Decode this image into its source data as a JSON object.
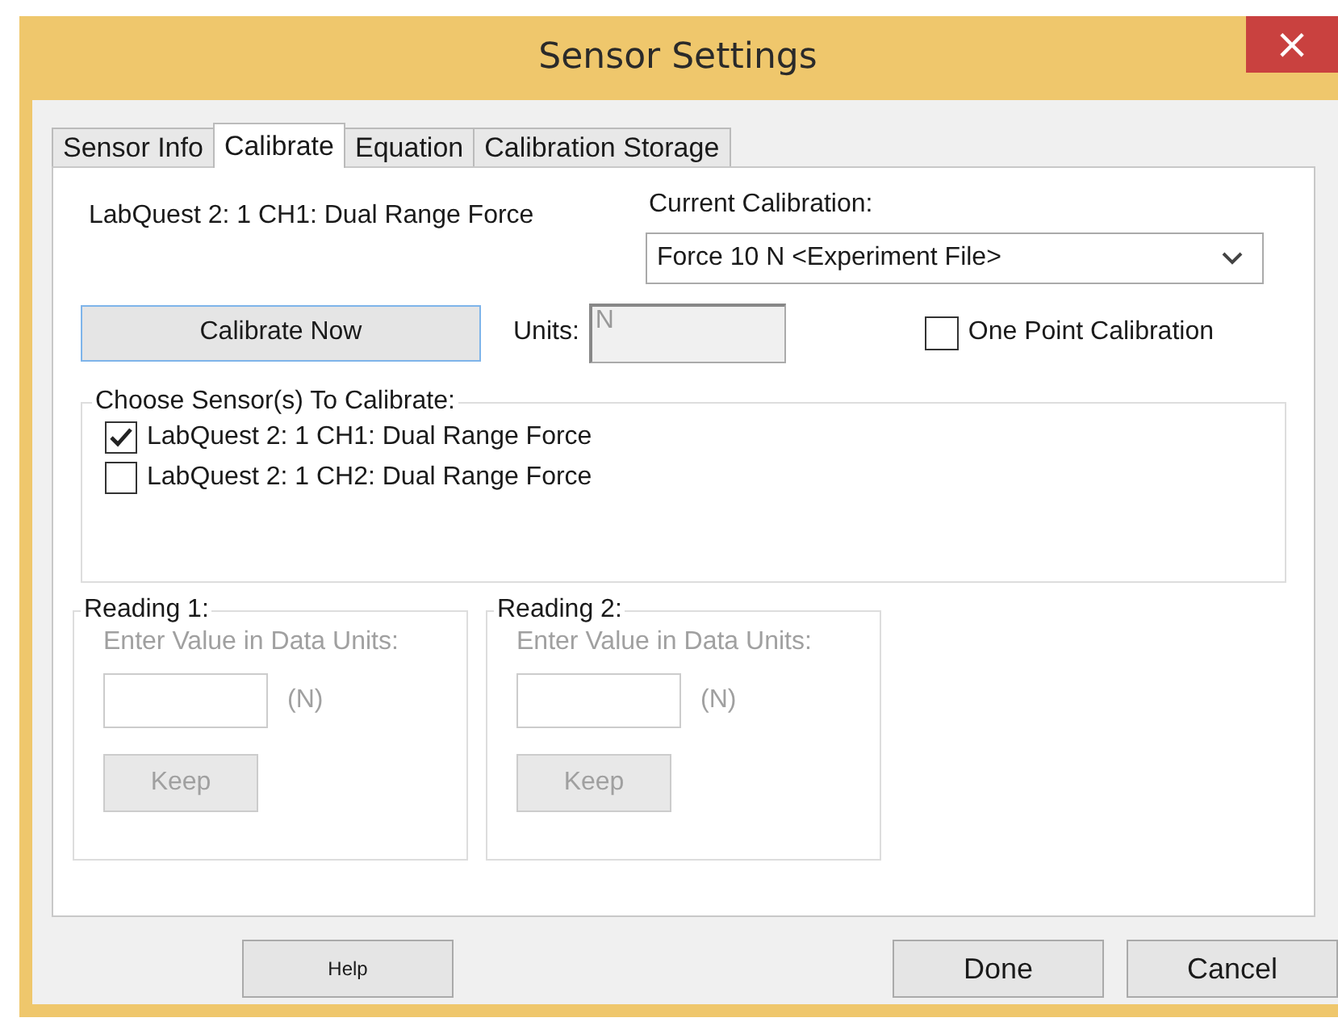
{
  "window": {
    "title": "Sensor Settings",
    "close": "×"
  },
  "tabs": [
    {
      "label": "Sensor Info",
      "selected": false
    },
    {
      "label": "Calibrate",
      "selected": true
    },
    {
      "label": "Equation",
      "selected": false
    },
    {
      "label": "Calibration Storage",
      "selected": false
    }
  ],
  "sensor_name": "LabQuest 2: 1 CH1: Dual Range Force",
  "current_calibration": {
    "label": "Current Calibration:",
    "value": "Force 10 N <Experiment File>"
  },
  "calibrate_button": "Calibrate Now",
  "units": {
    "label": "Units:",
    "value": "N",
    "disabled": true
  },
  "one_point": {
    "label": "One Point Calibration",
    "checked": false
  },
  "sensors_group": {
    "title": "Choose Sensor(s) To Calibrate:",
    "items": [
      {
        "label": "LabQuest 2: 1 CH1: Dual Range Force",
        "checked": true
      },
      {
        "label": "LabQuest 2: 1 CH2: Dual Range Force",
        "checked": false
      }
    ]
  },
  "readings": [
    {
      "title": "Reading 1:",
      "prompt": "Enter Value in Data Units:",
      "unit": "(N)",
      "button": "Keep",
      "disabled": true
    },
    {
      "title": "Reading 2:",
      "prompt": "Enter Value in Data Units:",
      "unit": "(N)",
      "button": "Keep",
      "disabled": true
    }
  ],
  "buttons": {
    "help": "Help",
    "done": "Done",
    "cancel": "Cancel"
  }
}
